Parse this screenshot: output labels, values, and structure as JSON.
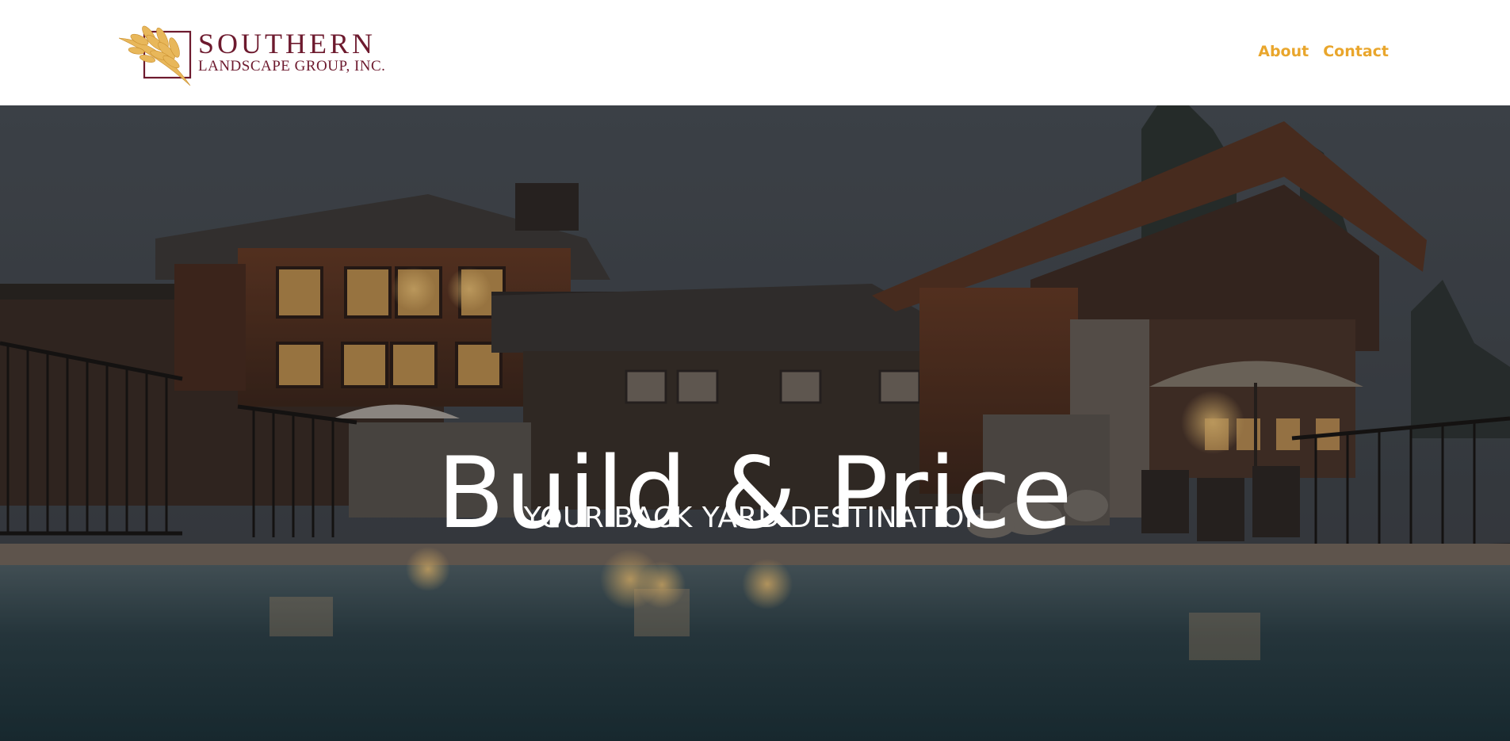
{
  "brand": {
    "line1": "SOUTHERN",
    "line2": "LANDSCAPE GROUP, INC.",
    "logo_icon": "wheat-leaf-logo-icon",
    "primary_color": "#6d1a2e",
    "leaf_color": "#e8b75a"
  },
  "nav": {
    "items": [
      {
        "label": "About"
      },
      {
        "label": "Contact"
      }
    ],
    "link_color": "#e9a62c"
  },
  "hero": {
    "title": "Build & Price",
    "subtitle": "YOUR BACK YARD DESTINATION"
  }
}
